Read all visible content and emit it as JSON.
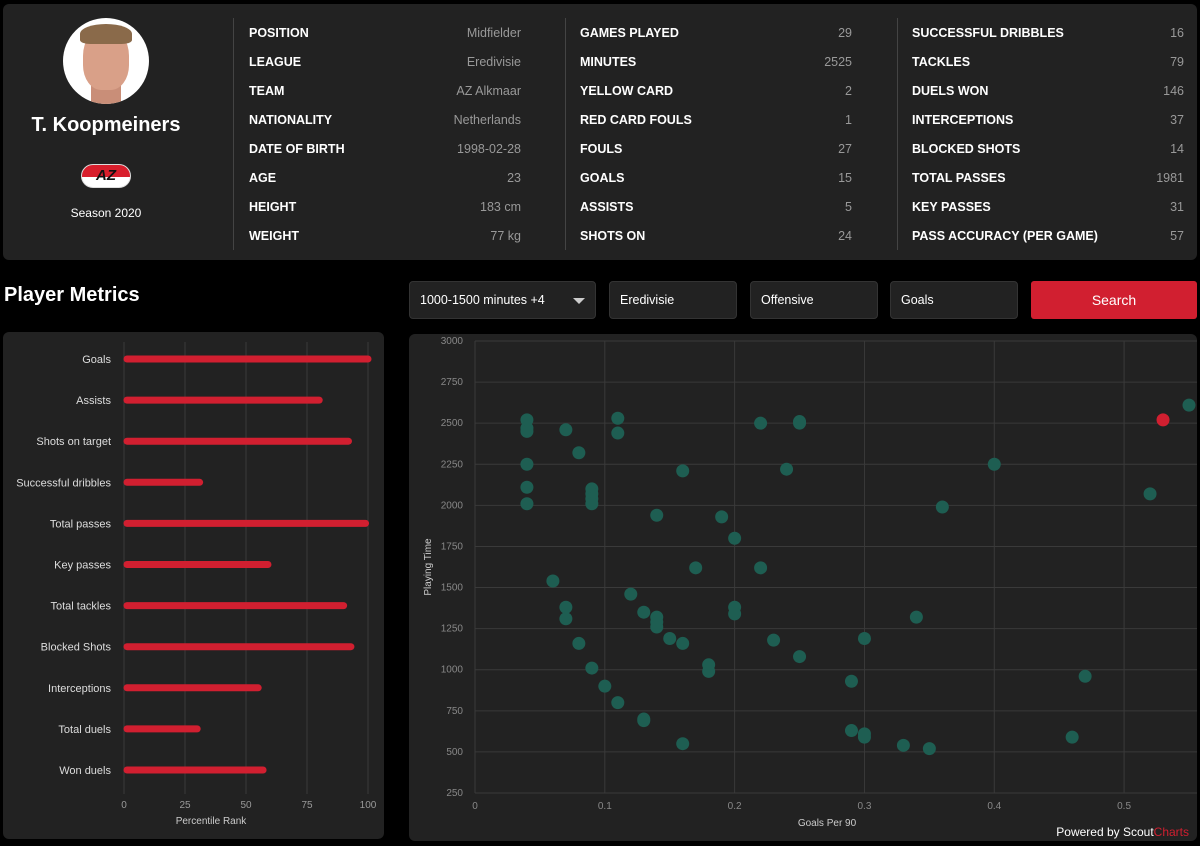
{
  "player": {
    "name": "T. Koopmeiners",
    "season": "Season 2020",
    "club_logo_text": "AZ"
  },
  "info": [
    {
      "label": "POSITION",
      "value": "Midfielder"
    },
    {
      "label": "LEAGUE",
      "value": "Eredivisie"
    },
    {
      "label": "TEAM",
      "value": "AZ Alkmaar"
    },
    {
      "label": "NATIONALITY",
      "value": "Netherlands"
    },
    {
      "label": "DATE OF BIRTH",
      "value": "1998-02-28"
    },
    {
      "label": "AGE",
      "value": "23"
    },
    {
      "label": "HEIGHT",
      "value": "183 cm"
    },
    {
      "label": "WEIGHT",
      "value": "77 kg"
    }
  ],
  "stats1": [
    {
      "label": "GAMES PLAYED",
      "value": "29"
    },
    {
      "label": "MINUTES",
      "value": "2525"
    },
    {
      "label": "YELLOW CARD",
      "value": "2"
    },
    {
      "label": "RED CARD FOULS",
      "value": "1"
    },
    {
      "label": "FOULS",
      "value": "27"
    },
    {
      "label": "GOALS",
      "value": "15"
    },
    {
      "label": "ASSISTS",
      "value": "5"
    },
    {
      "label": "SHOTS ON",
      "value": "24"
    }
  ],
  "stats2": [
    {
      "label": "SUCCESSFUL DRIBBLES",
      "value": "16"
    },
    {
      "label": "TACKLES",
      "value": "79"
    },
    {
      "label": "DUELS WON",
      "value": "146"
    },
    {
      "label": "INTERCEPTIONS",
      "value": "37"
    },
    {
      "label": "BLOCKED SHOTS",
      "value": "14"
    },
    {
      "label": "TOTAL PASSES",
      "value": "1981"
    },
    {
      "label": "KEY PASSES",
      "value": "31"
    },
    {
      "label": "PASS ACCURACY (PER GAME)",
      "value": "57"
    }
  ],
  "metrics_title": "Player Metrics",
  "filters": {
    "minutes": "1000-1500 minutes  +4",
    "league": "Eredivisie",
    "category": "Offensive",
    "metric": "Goals",
    "search": "Search"
  },
  "colors": {
    "accent": "#d11f30",
    "point": "#1e5e52",
    "highlight": "#d11f30"
  },
  "footer": {
    "powered": "Powered by Scout",
    "brand": "Charts"
  },
  "chart_data": [
    {
      "type": "bar",
      "orientation": "horizontal",
      "categories": [
        "Goals",
        "Assists",
        "Shots on target",
        "Successful dribbles",
        "Total passes",
        "Key passes",
        "Total tackles",
        "Blocked Shots",
        "Interceptions",
        "Total duels",
        "Won duels"
      ],
      "values": [
        100,
        80,
        92,
        31,
        99,
        59,
        90,
        93,
        55,
        30,
        57
      ],
      "xlabel": "Percentile Rank",
      "xlim": [
        0,
        100
      ],
      "xticks": [
        0,
        25,
        50,
        75,
        100
      ],
      "grid": true
    },
    {
      "type": "scatter",
      "xlabel": "Goals Per 90",
      "ylabel": "Playing Time",
      "xlim": [
        0,
        0.55
      ],
      "ylim": [
        250,
        3000
      ],
      "xticks": [
        0,
        0.1,
        0.2,
        0.3,
        0.4,
        0.5
      ],
      "yticks": [
        250,
        500,
        750,
        1000,
        1250,
        1500,
        1750,
        2000,
        2250,
        2500,
        2750,
        3000
      ],
      "grid": true,
      "points": [
        [
          0.04,
          2520
        ],
        [
          0.04,
          2470
        ],
        [
          0.04,
          2450
        ],
        [
          0.04,
          2250
        ],
        [
          0.04,
          2110
        ],
        [
          0.04,
          2010
        ],
        [
          0.07,
          2460
        ],
        [
          0.08,
          2320
        ],
        [
          0.09,
          2100
        ],
        [
          0.09,
          2070
        ],
        [
          0.09,
          2040
        ],
        [
          0.09,
          2010
        ],
        [
          0.11,
          2530
        ],
        [
          0.11,
          2440
        ],
        [
          0.16,
          2210
        ],
        [
          0.14,
          1940
        ],
        [
          0.19,
          1930
        ],
        [
          0.2,
          1800
        ],
        [
          0.17,
          1620
        ],
        [
          0.22,
          1620
        ],
        [
          0.22,
          2500
        ],
        [
          0.25,
          2500
        ],
        [
          0.25,
          2510
        ],
        [
          0.24,
          2220
        ],
        [
          0.06,
          1540
        ],
        [
          0.07,
          1380
        ],
        [
          0.07,
          1310
        ],
        [
          0.08,
          1160
        ],
        [
          0.09,
          1010
        ],
        [
          0.1,
          900
        ],
        [
          0.11,
          800
        ],
        [
          0.13,
          700
        ],
        [
          0.13,
          690
        ],
        [
          0.16,
          550
        ],
        [
          0.12,
          1460
        ],
        [
          0.13,
          1350
        ],
        [
          0.14,
          1320
        ],
        [
          0.14,
          1290
        ],
        [
          0.14,
          1260
        ],
        [
          0.15,
          1190
        ],
        [
          0.16,
          1160
        ],
        [
          0.18,
          1030
        ],
        [
          0.18,
          990
        ],
        [
          0.2,
          1380
        ],
        [
          0.2,
          1340
        ],
        [
          0.23,
          1180
        ],
        [
          0.25,
          1080
        ],
        [
          0.29,
          930
        ],
        [
          0.3,
          1190
        ],
        [
          0.29,
          630
        ],
        [
          0.3,
          610
        ],
        [
          0.3,
          590
        ],
        [
          0.33,
          540
        ],
        [
          0.35,
          520
        ],
        [
          0.34,
          1320
        ],
        [
          0.36,
          1990
        ],
        [
          0.4,
          2250
        ],
        [
          0.46,
          590
        ],
        [
          0.47,
          960
        ],
        [
          0.52,
          2070
        ],
        [
          0.55,
          2610
        ]
      ],
      "highlight": [
        0.53,
        2520
      ]
    }
  ]
}
